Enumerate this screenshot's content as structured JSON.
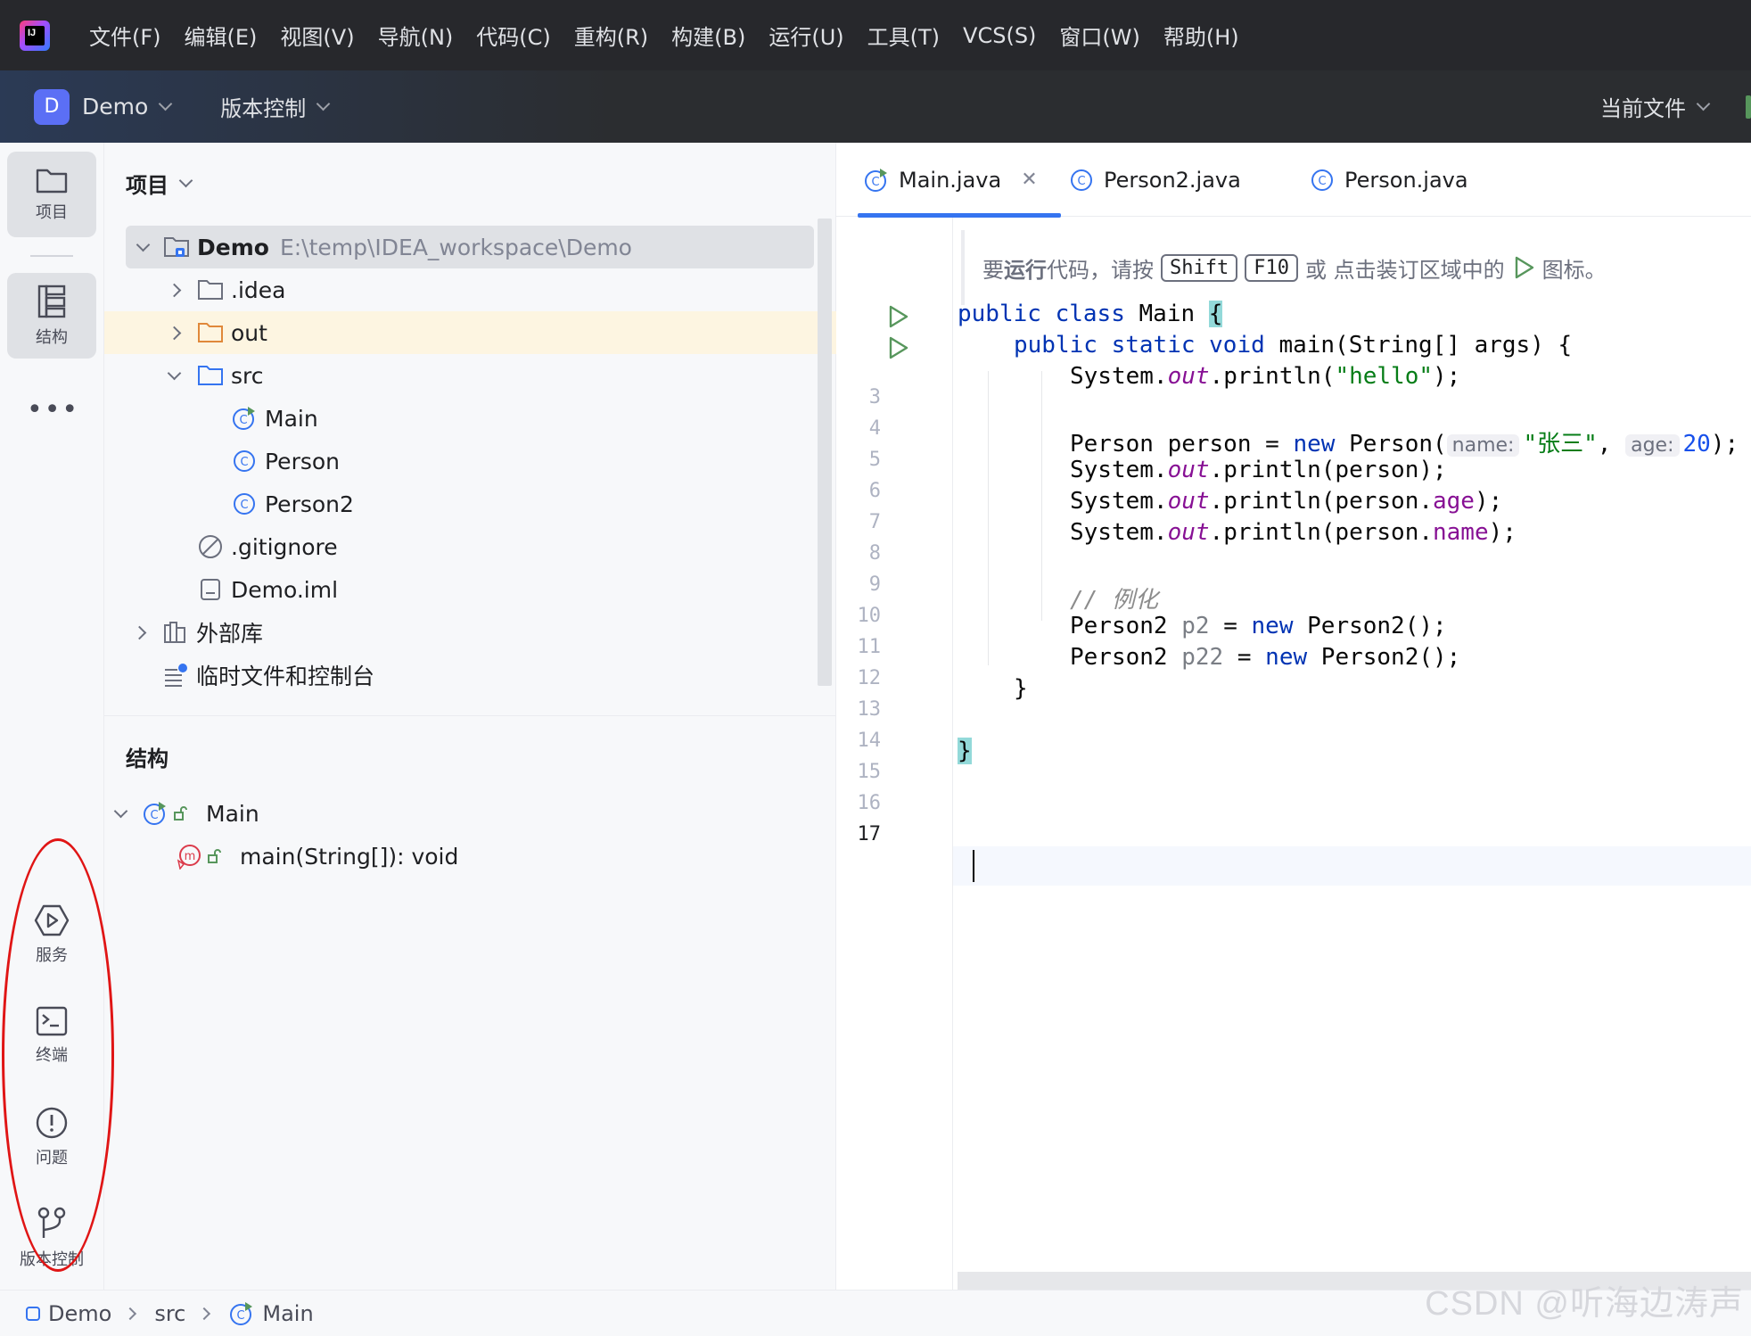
{
  "menubar": {
    "logo_text": "IJ",
    "items": [
      "文件(F)",
      "编辑(E)",
      "视图(V)",
      "导航(N)",
      "代码(C)",
      "重构(R)",
      "构建(B)",
      "运行(U)",
      "工具(T)",
      "VCS(S)",
      "窗口(W)",
      "帮助(H)"
    ]
  },
  "toolbar": {
    "project_badge": "D",
    "project_name": "Demo",
    "vcs_label": "版本控制",
    "run_config": "当前文件"
  },
  "left_strip": {
    "top_buttons": [
      {
        "label": "项目",
        "icon": "folder-icon"
      },
      {
        "label": "结构",
        "icon": "structure-icon"
      }
    ],
    "bottom_buttons": [
      {
        "label": "服务",
        "icon": "services-icon"
      },
      {
        "label": "终端",
        "icon": "terminal-icon"
      },
      {
        "label": "问题",
        "icon": "problems-icon"
      },
      {
        "label": "版本控制",
        "icon": "git-branch-icon"
      }
    ]
  },
  "project_panel": {
    "title": "项目",
    "tree": [
      {
        "label": "Demo",
        "path": "E:\\temp\\IDEA_workspace\\Demo"
      },
      {
        "label": ".idea"
      },
      {
        "label": "out"
      },
      {
        "label": "src"
      },
      {
        "label": "Main"
      },
      {
        "label": "Person"
      },
      {
        "label": "Person2"
      },
      {
        "label": ".gitignore"
      },
      {
        "label": "Demo.iml"
      },
      {
        "label": "外部库"
      },
      {
        "label": "临时文件和控制台"
      }
    ]
  },
  "structure_panel": {
    "title": "结构",
    "items": [
      {
        "label": "Main"
      },
      {
        "label": "main(String[]): void"
      }
    ]
  },
  "editor": {
    "tabs": [
      {
        "label": "Main.java",
        "active": true
      },
      {
        "label": "Person2.java",
        "active": false
      },
      {
        "label": "Person.java",
        "active": false
      }
    ],
    "hint": {
      "prefix_normal": "要",
      "prefix_bold": "运行",
      "text1": "代码，请按",
      "key1": "Shift",
      "key2": "F10",
      "text2": "或 点击装订区域中的",
      "text3": "图标。"
    },
    "line_numbers": [
      "3",
      "4",
      "5",
      "6",
      "7",
      "8",
      "9",
      "10",
      "11",
      "12",
      "13",
      "14",
      "15",
      "16",
      "17"
    ],
    "code": {
      "l3_kw1": "public",
      "l3_kw2": "class",
      "l3_name": "Main",
      "l3_brace": "{",
      "l4_kw1": "public",
      "l4_kw2": "static",
      "l4_kw3": "void",
      "l4_rest": "main(String[] args) {",
      "l5_a": "System.",
      "l5_out": "out",
      "l5_b": ".println(",
      "l5_str": "\"hello\"",
      "l5_c": ");",
      "l7_a": "Person person = ",
      "l7_new": "new",
      "l7_b": " Person(",
      "l7_hint1": "name:",
      "l7_str": "\"张三\"",
      "l7_c": ", ",
      "l7_hint2": "age:",
      "l7_num": "20",
      "l7_d": ");",
      "l8_a": "System.",
      "l8_out": "out",
      "l8_b": ".println(person);",
      "l9_a": "System.",
      "l9_out": "out",
      "l9_b": ".println(person.",
      "l9_fld": "age",
      "l9_c": ");",
      "l10_a": "System.",
      "l10_out": "out",
      "l10_b": ".println(person.",
      "l10_fld": "name",
      "l10_c": ");",
      "l12_cmt": "// 例化",
      "l13_a": "Person2 ",
      "l13_var": "p2",
      "l13_b": " = ",
      "l13_new": "new",
      "l13_c": " Person2();",
      "l14_a": "Person2 ",
      "l14_var": "p22",
      "l14_b": " = ",
      "l14_new": "new",
      "l14_c": " Person2();",
      "l15": "}",
      "l17": "}"
    }
  },
  "statusbar": {
    "breadcrumbs": [
      "Demo",
      "src",
      "Main"
    ]
  },
  "watermark": "CSDN @听海边涛声",
  "colors": {
    "accent": "#3574f0",
    "run_green": "#57965c",
    "annotation_red": "#e01515"
  }
}
